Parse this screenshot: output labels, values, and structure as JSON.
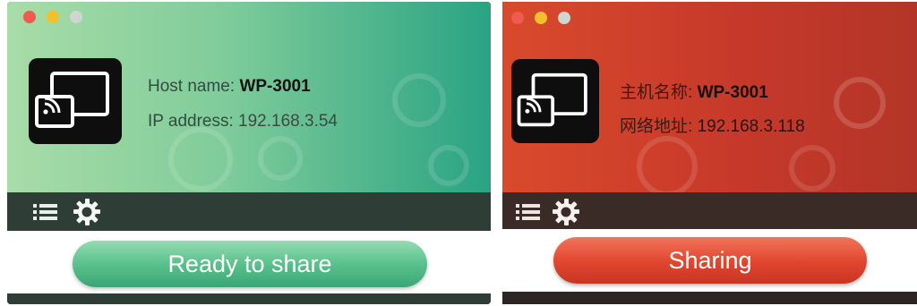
{
  "panels": {
    "en": {
      "host_label": "Host name:",
      "host_value": "WP-3001",
      "ip_label": "IP address:",
      "ip_value": "192.168.3.54",
      "button_label": "Ready to share",
      "status_color": "#4dbb88"
    },
    "zh": {
      "host_label": "主机名称:",
      "host_value": "WP-3001",
      "ip_label": "网络地址:",
      "ip_value": "192.168.3.118",
      "button_label": "Sharing",
      "status_color": "#d9432d"
    }
  },
  "icons": [
    "cast-screen-icon",
    "list-icon",
    "gear-icon"
  ]
}
